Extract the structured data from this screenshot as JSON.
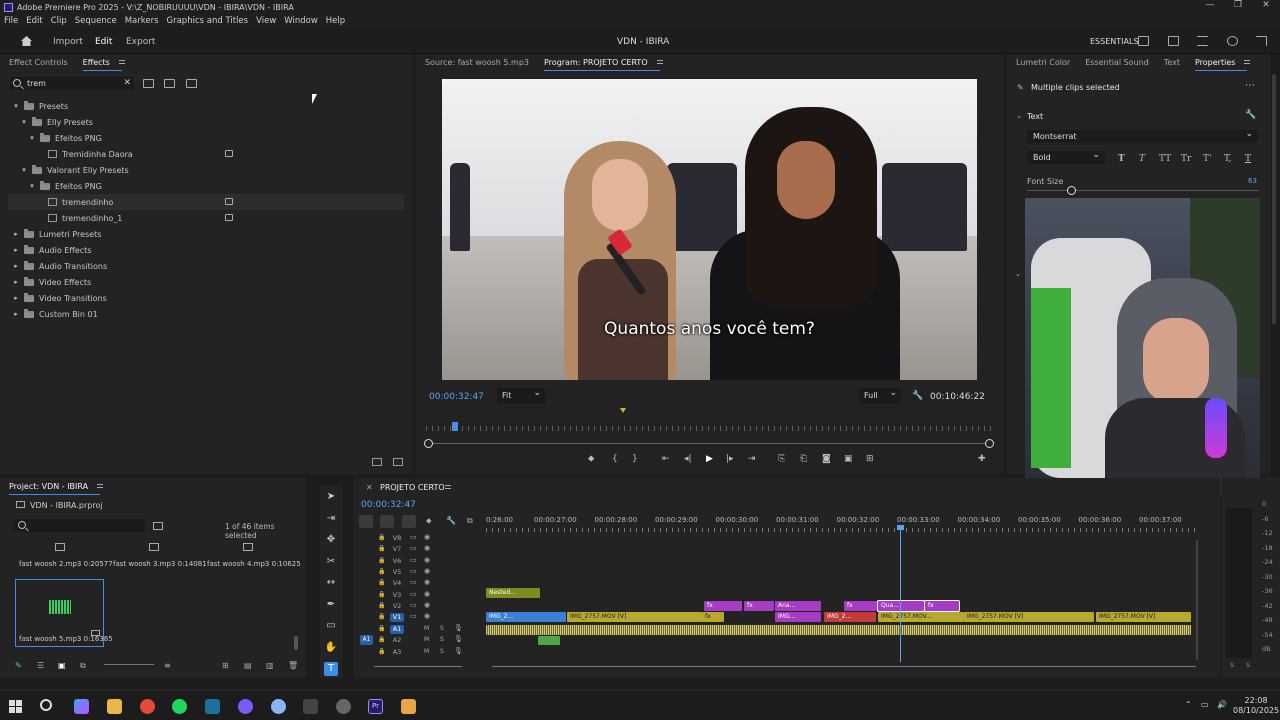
{
  "window": {
    "title": "Adobe Premiere Pro 2025 - V:\\Z_NOBIRUUUU\\VDN - IBIRA\\VDN - IBIRA"
  },
  "menubar": [
    "File",
    "Edit",
    "Clip",
    "Sequence",
    "Markers",
    "Graphics and Titles",
    "View",
    "Window",
    "Help"
  ],
  "workspace": {
    "tabs": [
      "Import",
      "Edit",
      "Export"
    ],
    "active": "Edit",
    "project_title": "VDN - IBIRA",
    "essentials": "ESSENTIALS"
  },
  "effects_panel": {
    "tabs": [
      "Effect Controls",
      "Effects"
    ],
    "search_value": "trem",
    "tree": [
      {
        "label": "Presets",
        "level": 0,
        "type": "folder",
        "open": true
      },
      {
        "label": "Elly Presets",
        "level": 1,
        "type": "folder",
        "open": true
      },
      {
        "label": "Efeitos PNG",
        "level": 2,
        "type": "folder",
        "open": true
      },
      {
        "label": "Tremidinha Daora",
        "level": 3,
        "type": "preset"
      },
      {
        "label": "Valorant Elly Presets",
        "level": 1,
        "type": "folder",
        "open": true
      },
      {
        "label": "Efeitos PNG",
        "level": 2,
        "type": "folder",
        "open": true
      },
      {
        "label": "tremendinho",
        "level": 3,
        "type": "preset",
        "selected": true
      },
      {
        "label": "tremendinho_1",
        "level": 3,
        "type": "preset"
      },
      {
        "label": "Lumetri Presets",
        "level": 0,
        "type": "folder"
      },
      {
        "label": "Audio Effects",
        "level": 0,
        "type": "folder"
      },
      {
        "label": "Audio Transitions",
        "level": 0,
        "type": "folder"
      },
      {
        "label": "Video Effects",
        "level": 0,
        "type": "folder"
      },
      {
        "label": "Video Transitions",
        "level": 0,
        "type": "folder"
      },
      {
        "label": "Custom Bin 01",
        "level": 0,
        "type": "folder"
      }
    ]
  },
  "monitor": {
    "tabs": [
      "Source: fast woosh 5.mp3",
      "Program: PROJETO CERTO"
    ],
    "subtitle": "Quantos anos você tem?",
    "current_timecode": "00:00:32:47",
    "fit": "Fit",
    "quality": "Full",
    "duration": "00:10:46:22"
  },
  "properties": {
    "tabs": [
      "Lumetri Color",
      "Essential Sound",
      "Text",
      "Properties"
    ],
    "header": "Multiple clips selected",
    "section": "Text",
    "font": "Montserrat",
    "style": "Bold",
    "text_buttons": [
      "T",
      "T",
      "TT",
      "Tr",
      "T'",
      "T,",
      "T"
    ],
    "font_size_label": "Font Size",
    "font_size_value": "63"
  },
  "project": {
    "tab": "Project: VDN - IBIRA",
    "file": "VDN - IBIRA.prproj",
    "count": "1 of 46 items selected",
    "items": [
      {
        "name": "fast woosh 2.mp3",
        "dur": "0:20577"
      },
      {
        "name": "fast woosh 3.mp3",
        "dur": "0:14081"
      },
      {
        "name": "fast woosh 4.mp3",
        "dur": "0:10625"
      },
      {
        "name": "fast woosh 5.mp3",
        "dur": "0:16385"
      }
    ]
  },
  "timeline": {
    "sequence": "PROJETO CERTO",
    "timecode": "00:00:32:47",
    "ruler": [
      "0:26:00",
      "00:00:27:00",
      "00:00:28:00",
      "00:00:29:00",
      "00:00:30:00",
      "00:00:31:00",
      "00:00:32:00",
      "00:00:33:00",
      "00:00:34:00",
      "00:00:35:00",
      "00:00:36:00",
      "00:00:37:00"
    ],
    "video_tracks": [
      "V8",
      "V7",
      "V6",
      "V5",
      "V4",
      "V3",
      "V2",
      "V1"
    ],
    "audio_tracks": [
      "A1",
      "A2",
      "A3"
    ],
    "clips": {
      "nested": "Nested...",
      "v1a": "IMG_2...",
      "v1b": "IMG_2757.MOV [V]",
      "v1c": "IMG...",
      "v1d": "IMG_2...",
      "v1e": "IMG_2757.MOV...",
      "v1f": "IMG_2757.MOV [V]",
      "v1g": "IMG_2757.MOV [V]",
      "v2a": "Ana...",
      "v2b": "Qua...",
      "fx": "fx"
    }
  },
  "meters": {
    "labels": [
      "0",
      "-6",
      "-12",
      "-18",
      "-24",
      "-30",
      "-36",
      "-42",
      "-48",
      "-54",
      "dB"
    ],
    "bottom": [
      "S",
      "S"
    ]
  },
  "taskbar": {
    "time": "22:08",
    "date": "08/10/2025"
  }
}
